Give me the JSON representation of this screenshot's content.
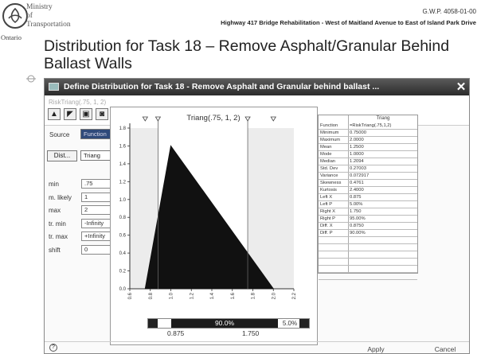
{
  "slide": {
    "ministry_lines": [
      "Ministry",
      "of",
      "Transportation"
    ],
    "ontario": "Ontario",
    "doc_id": "G.W.P. 4058-01-00",
    "header": "Highway 417 Bridge Rehabilitation - West of Maitland Avenue to East of Island Park Drive",
    "title": "Distribution for Task 18 – Remove Asphalt/Granular Behind Ballast Walls"
  },
  "dialog": {
    "title": "Define Distribution for Task 18 - Remove Asphalt and Granular behind ballast ...",
    "formula": "RiskTriang(.75, 1, 2)",
    "source_label": "Source",
    "source_value": "Function",
    "dist_button": "Dist...",
    "dist_value": "Triang",
    "params": [
      {
        "label": "min",
        "value": ".75"
      },
      {
        "label": "m. likely",
        "value": "1"
      },
      {
        "label": "max",
        "value": "2"
      },
      {
        "label": "tr. min",
        "value": "-Infinity"
      },
      {
        "label": "tr. max",
        "value": "+Infinity"
      },
      {
        "label": "shift",
        "value": "0"
      }
    ],
    "apply": "Apply",
    "cancel": "Cancel",
    "help_glyph": "?"
  },
  "chart_data": {
    "type": "area",
    "title": "Triang(.75, 1, 2)",
    "x": [
      0.75,
      1.0,
      2.0
    ],
    "y": [
      0.0,
      1.6,
      0.0
    ],
    "xlim": [
      0.6,
      2.2
    ],
    "ylim": [
      0.0,
      1.8
    ],
    "x_ticks": [
      "0.6",
      "0.8",
      "1.0",
      "1.2",
      "1.4",
      "1.6",
      "1.8",
      "2.0",
      "2.2"
    ],
    "y_ticks": [
      "0.0",
      "0.2",
      "0.4",
      "0.6",
      "0.8",
      "1.0",
      "1.2",
      "1.4",
      "1.6",
      "1.8"
    ],
    "delimiters": [
      0.875,
      1.75
    ],
    "slider": {
      "left_value": "0.875",
      "right_value": "1.750",
      "middle_pct": "90.0%",
      "right_pct": "5.0%"
    }
  },
  "stats": {
    "header": "Triang",
    "rows": [
      {
        "key": "Function",
        "value": "=RiskTriang(.75,1,2)"
      },
      {
        "key": "Minimum",
        "value": "0.75000"
      },
      {
        "key": "Maximum",
        "value": "2.0000"
      },
      {
        "key": "Mean",
        "value": "1.2500"
      },
      {
        "key": "Mode",
        "value": "1.0000"
      },
      {
        "key": "Median",
        "value": "1.2094"
      },
      {
        "key": "Std. Dev",
        "value": "0.27003"
      },
      {
        "key": "Variance",
        "value": "0.072917"
      },
      {
        "key": "Skewness",
        "value": "0.4761"
      },
      {
        "key": "Kurtosis",
        "value": "2.4000"
      },
      {
        "key": "Left X",
        "value": "0.875"
      },
      {
        "key": "Left P",
        "value": "5.00%"
      },
      {
        "key": "Right X",
        "value": "1.750"
      },
      {
        "key": "Right P",
        "value": "95.00%"
      },
      {
        "key": "Diff. X",
        "value": "0.8750"
      },
      {
        "key": "Diff. P",
        "value": "90.00%"
      },
      {
        "key": "",
        "value": ""
      },
      {
        "key": "",
        "value": ""
      },
      {
        "key": "",
        "value": ""
      },
      {
        "key": "",
        "value": ""
      },
      {
        "key": "",
        "value": ""
      },
      {
        "key": "",
        "value": ""
      }
    ]
  }
}
